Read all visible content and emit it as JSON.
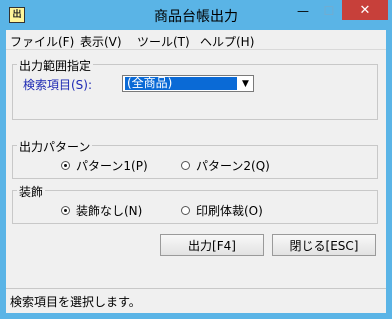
{
  "window": {
    "title": "商品台帳出力",
    "icon_text": "出",
    "minimize_glyph": "—",
    "maximize_glyph": "☐",
    "close_glyph": "✕"
  },
  "menu": [
    {
      "label": "ファイル(F)"
    },
    {
      "label": "表示(V)"
    },
    {
      "label": "ツール(T)"
    },
    {
      "label": "ヘルプ(H)"
    }
  ],
  "output_range": {
    "group_title": "出力範囲指定",
    "search_item_label": "検索項目(S):",
    "search_item_value": "(全商品)",
    "dropdown_glyph": "▼"
  },
  "output_pattern": {
    "group_title": "出力パターン",
    "options": [
      {
        "label": "パターン1(P)",
        "selected": true
      },
      {
        "label": "パターン2(Q)",
        "selected": false
      }
    ]
  },
  "decoration": {
    "group_title": "装飾",
    "options": [
      {
        "label": "装飾なし(N)",
        "selected": true
      },
      {
        "label": "印刷体裁(O)",
        "selected": false
      }
    ]
  },
  "buttons": {
    "output": "出力[F4]",
    "close": "閉じる[ESC]"
  },
  "status": {
    "text": "検索項目を選択します。"
  }
}
